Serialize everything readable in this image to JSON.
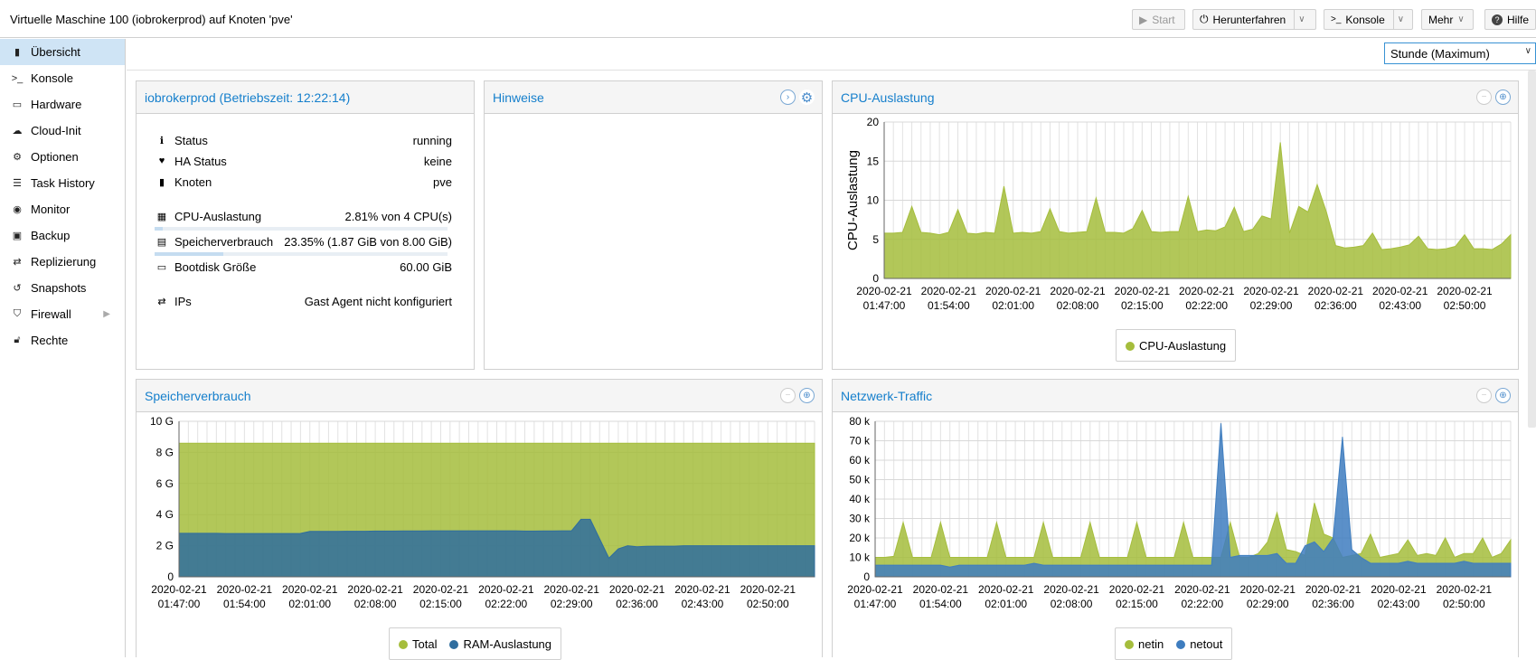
{
  "window_title": "Virtuelle Maschine 100 (iobrokerprod) auf Knoten 'pve'",
  "toolbar": {
    "start": "Start",
    "shutdown": "Herunterfahren",
    "console": "Konsole",
    "more": "Mehr",
    "help": "Hilfe"
  },
  "timeframe": "Stunde (Maximum)",
  "sidebar": [
    {
      "label": "Übersicht",
      "icon": "book-icon"
    },
    {
      "label": "Konsole",
      "icon": "terminal-icon"
    },
    {
      "label": "Hardware",
      "icon": "monitor-icon"
    },
    {
      "label": "Cloud-Init",
      "icon": "cloud-icon"
    },
    {
      "label": "Optionen",
      "icon": "gear-icon"
    },
    {
      "label": "Task History",
      "icon": "list-icon"
    },
    {
      "label": "Monitor",
      "icon": "eye-icon"
    },
    {
      "label": "Backup",
      "icon": "floppy-icon"
    },
    {
      "label": "Replizierung",
      "icon": "retweet-icon"
    },
    {
      "label": "Snapshots",
      "icon": "history-icon"
    },
    {
      "label": "Firewall",
      "icon": "shield-icon"
    },
    {
      "label": "Rechte",
      "icon": "unlock-icon"
    }
  ],
  "status": {
    "title": "iobrokerprod (Betriebszeit: 12:22:14)",
    "status_label": "Status",
    "status_value": "running",
    "ha_label": "HA Status",
    "ha_value": "keine",
    "node_label": "Knoten",
    "node_value": "pve",
    "cpu_label": "CPU-Auslastung",
    "cpu_value": "2.81% von 4 CPU(s)",
    "cpu_fraction": 0.0281,
    "mem_label": "Speicherverbrauch",
    "mem_value": "23.35% (1.87 GiB von 8.00 GiB)",
    "mem_fraction": 0.2335,
    "disk_label": "Bootdisk Größe",
    "disk_value": "60.00 GiB",
    "ips_label": "IPs",
    "ips_value": "Gast Agent nicht konfiguriert"
  },
  "notes": {
    "title": "Hinweise"
  },
  "cpu_panel": {
    "title": "CPU-Auslastung"
  },
  "mem_panel": {
    "title": "Speicherverbrauch"
  },
  "net_panel": {
    "title": "Netzwerk-Traffic"
  },
  "chart_data": [
    {
      "type": "area",
      "title": "CPU-Auslastung",
      "ylabel": "CPU-Auslastung",
      "ylim": [
        0,
        20
      ],
      "yticks": [
        "0",
        "5",
        "10",
        "15",
        "20"
      ],
      "x_ticks": [
        [
          "2020-02-21",
          "01:47:00"
        ],
        [
          "2020-02-21",
          "01:54:00"
        ],
        [
          "2020-02-21",
          "02:01:00"
        ],
        [
          "2020-02-21",
          "02:08:00"
        ],
        [
          "2020-02-21",
          "02:15:00"
        ],
        [
          "2020-02-21",
          "02:22:00"
        ],
        [
          "2020-02-21",
          "02:29:00"
        ],
        [
          "2020-02-21",
          "02:36:00"
        ],
        [
          "2020-02-21",
          "02:43:00"
        ],
        [
          "2020-02-21",
          "02:50:00"
        ]
      ],
      "series": [
        {
          "name": "CPU-Auslastung",
          "color": "#a5bd3c",
          "values": [
            5.8,
            5.8,
            5.9,
            9.2,
            5.9,
            5.8,
            5.6,
            5.9,
            8.8,
            5.8,
            5.7,
            5.9,
            5.8,
            11.8,
            5.8,
            5.9,
            5.8,
            6,
            8.9,
            6,
            5.8,
            5.9,
            6,
            10.3,
            5.9,
            5.9,
            5.8,
            6.4,
            8.7,
            6,
            5.9,
            6,
            6,
            10.5,
            6,
            6.2,
            6.1,
            6.6,
            9.1,
            6,
            6.3,
            8,
            7.6,
            17.4,
            5.8,
            9.2,
            8.5,
            12,
            8.5,
            4.2,
            3.9,
            4,
            4.2,
            5.8,
            3.7,
            3.8,
            4,
            4.3,
            5.4,
            3.8,
            3.7,
            3.8,
            4.1,
            5.6,
            3.8,
            3.8,
            3.7,
            4.4,
            5.6
          ]
        }
      ]
    },
    {
      "type": "area",
      "title": "Speicherverbrauch",
      "ylim": [
        0,
        10
      ],
      "yticks": [
        "0",
        "2 G",
        "4 G",
        "6 G",
        "8 G",
        "10 G"
      ],
      "x_ticks": [
        [
          "2020-02-21",
          "01:47:00"
        ],
        [
          "2020-02-21",
          "01:54:00"
        ],
        [
          "2020-02-21",
          "02:01:00"
        ],
        [
          "2020-02-21",
          "02:08:00"
        ],
        [
          "2020-02-21",
          "02:15:00"
        ],
        [
          "2020-02-21",
          "02:22:00"
        ],
        [
          "2020-02-21",
          "02:29:00"
        ],
        [
          "2020-02-21",
          "02:36:00"
        ],
        [
          "2020-02-21",
          "02:43:00"
        ],
        [
          "2020-02-21",
          "02:50:00"
        ]
      ],
      "series": [
        {
          "name": "Total",
          "color": "#a5bd3c",
          "values": [
            8.59,
            8.59,
            8.59,
            8.59,
            8.59,
            8.59,
            8.59,
            8.59,
            8.59,
            8.59,
            8.59,
            8.59,
            8.59,
            8.59,
            8.59,
            8.59,
            8.59,
            8.59,
            8.59,
            8.59,
            8.59,
            8.59,
            8.59,
            8.59,
            8.59,
            8.59,
            8.59,
            8.59,
            8.59,
            8.59,
            8.59,
            8.59,
            8.59,
            8.59,
            8.59,
            8.59,
            8.59,
            8.59,
            8.59,
            8.59,
            8.59,
            8.59,
            8.59,
            8.59,
            8.59,
            8.59,
            8.59,
            8.59,
            8.59,
            8.59,
            8.59,
            8.59,
            8.59,
            8.59,
            8.59,
            8.59,
            8.59,
            8.59,
            8.59,
            8.59,
            8.59,
            8.59,
            8.59,
            8.59,
            8.59,
            8.59,
            8.59,
            8.59,
            8.59
          ]
        },
        {
          "name": "RAM-Auslastung",
          "color": "#2f6d9e",
          "values": [
            2.8,
            2.8,
            2.8,
            2.8,
            2.8,
            2.78,
            2.78,
            2.78,
            2.78,
            2.78,
            2.78,
            2.78,
            2.78,
            2.79,
            2.92,
            2.92,
            2.92,
            2.92,
            2.93,
            2.93,
            2.93,
            2.94,
            2.94,
            2.94,
            2.95,
            2.95,
            2.95,
            2.96,
            2.96,
            2.96,
            2.96,
            2.96,
            2.96,
            2.96,
            2.96,
            2.96,
            2.96,
            2.94,
            2.94,
            2.95,
            2.95,
            2.96,
            2.96,
            3.7,
            3.7,
            2.45,
            1.2,
            1.8,
            2,
            1.93,
            1.96,
            1.97,
            1.97,
            1.97,
            2,
            2,
            2,
            2,
            2,
            2,
            2,
            2,
            2,
            2,
            2,
            2,
            2,
            2,
            2
          ]
        }
      ]
    },
    {
      "type": "area",
      "title": "Netzwerk-Traffic",
      "ylim": [
        0,
        80
      ],
      "yticks": [
        "0",
        "10 k",
        "20 k",
        "30 k",
        "40 k",
        "50 k",
        "60 k",
        "70 k",
        "80 k"
      ],
      "x_ticks": [
        [
          "2020-02-21",
          "01:47:00"
        ],
        [
          "2020-02-21",
          "01:54:00"
        ],
        [
          "2020-02-21",
          "02:01:00"
        ],
        [
          "2020-02-21",
          "02:08:00"
        ],
        [
          "2020-02-21",
          "02:15:00"
        ],
        [
          "2020-02-21",
          "02:22:00"
        ],
        [
          "2020-02-21",
          "02:29:00"
        ],
        [
          "2020-02-21",
          "02:36:00"
        ],
        [
          "2020-02-21",
          "02:43:00"
        ],
        [
          "2020-02-21",
          "02:50:00"
        ]
      ],
      "series": [
        {
          "name": "netin",
          "color": "#a5bd3c",
          "values": [
            10,
            10,
            10.5,
            28,
            10,
            10,
            10,
            28,
            10,
            10,
            10,
            10,
            10,
            28,
            10,
            10,
            10,
            10,
            28,
            10,
            10,
            10,
            10,
            28,
            10,
            10,
            10,
            10,
            28,
            10,
            10,
            10,
            10,
            28,
            10,
            10,
            10,
            10,
            28,
            10,
            10,
            12,
            18,
            33,
            14,
            13,
            11,
            38,
            22,
            20,
            10,
            11,
            12,
            22,
            10,
            11,
            12,
            19,
            11,
            12,
            11,
            20,
            10,
            12,
            12,
            20,
            10,
            12,
            19
          ]
        },
        {
          "name": "netout",
          "color": "#3e7dbf",
          "values": [
            6,
            6,
            6,
            6,
            6,
            6,
            6,
            6,
            5,
            6,
            6,
            6,
            6,
            6,
            6,
            6,
            6,
            7,
            6,
            6,
            6,
            6,
            6,
            6,
            6,
            6,
            6,
            6,
            6,
            6,
            6,
            6,
            6,
            6,
            6,
            6,
            6,
            79,
            10,
            11,
            11,
            11,
            11,
            12,
            7,
            7,
            16,
            18,
            13,
            20,
            72,
            14,
            10,
            7,
            7,
            7,
            7,
            8,
            7,
            7,
            7,
            7,
            7,
            8,
            7,
            7,
            7,
            7,
            7
          ]
        }
      ]
    }
  ]
}
